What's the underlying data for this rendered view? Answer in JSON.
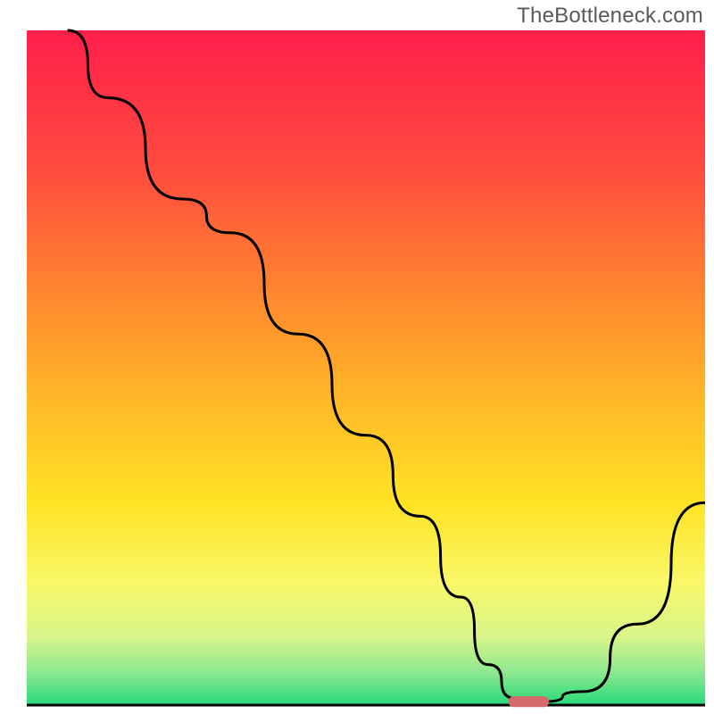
{
  "watermark": "TheBottleneck.com",
  "chart_data": {
    "type": "line",
    "title": "",
    "xlabel": "",
    "ylabel": "",
    "xlim": [
      0,
      100
    ],
    "ylim": [
      0,
      100
    ],
    "grid": false,
    "legend": false,
    "background": {
      "type": "vertical-gradient",
      "stops": [
        {
          "pos": 0.0,
          "color": "#ff1f4a"
        },
        {
          "pos": 0.2,
          "color": "#ff4a3f"
        },
        {
          "pos": 0.4,
          "color": "#ff8a2e"
        },
        {
          "pos": 0.55,
          "color": "#ffb928"
        },
        {
          "pos": 0.7,
          "color": "#ffe324"
        },
        {
          "pos": 0.82,
          "color": "#f8f86a"
        },
        {
          "pos": 0.9,
          "color": "#d8f58a"
        },
        {
          "pos": 0.95,
          "color": "#8fe88f"
        },
        {
          "pos": 1.0,
          "color": "#28d97a"
        }
      ]
    },
    "series": [
      {
        "name": "bottleneck-curve",
        "color": "#000000",
        "x": [
          6,
          12,
          23,
          30,
          40,
          50,
          58,
          64,
          68,
          72,
          76,
          82,
          90,
          100
        ],
        "y": [
          100,
          90,
          75,
          70,
          55,
          40,
          28,
          16,
          6,
          1,
          0.5,
          2,
          12,
          30
        ]
      }
    ],
    "marker": {
      "name": "current-point",
      "x": 74,
      "y": 0.5,
      "width_pct": 6,
      "height_pct": 1.6,
      "color": "#d46a6a"
    },
    "baseline": {
      "y": 0,
      "color": "#000000"
    }
  }
}
